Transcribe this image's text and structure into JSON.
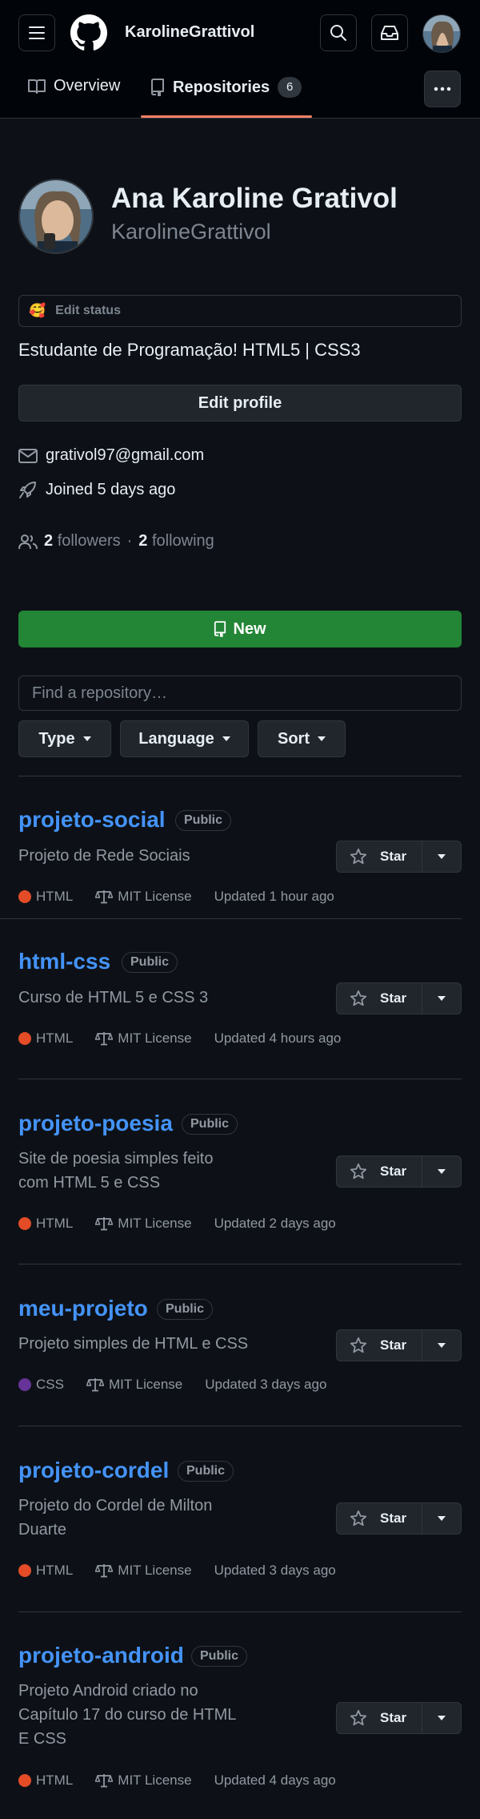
{
  "header": {
    "username": "KarolineGrattivol",
    "tabs": [
      {
        "label": "Overview"
      },
      {
        "label": "Repositories",
        "count": "6"
      }
    ]
  },
  "profile": {
    "full_name": "Ana Karoline Grativol",
    "login": "KarolineGrattivol",
    "status_label": "Edit status",
    "status_emoji": "🥰",
    "bio": "Estudante de Programação! HTML5 | CSS3",
    "edit_profile_label": "Edit profile",
    "email": "grativol97@gmail.com",
    "joined": "Joined 5 days ago",
    "followers_count": "2",
    "followers_label": "followers",
    "separator": "·",
    "following_count": "2",
    "following_label": "following"
  },
  "repos_toolbar": {
    "new_label": "New",
    "find_placeholder": "Find a repository…",
    "filters": [
      "Type",
      "Language",
      "Sort"
    ]
  },
  "repositories": [
    {
      "name": "projeto-social",
      "visibility": "Public",
      "description": "Projeto de Rede Sociais",
      "language": "HTML",
      "language_color": "#e34c26",
      "license": "MIT License",
      "updated": "Updated 1 hour ago",
      "star_label": "Star"
    },
    {
      "name": "html-css",
      "visibility": "Public",
      "description": "Curso de HTML 5 e CSS 3",
      "language": "HTML",
      "language_color": "#e34c26",
      "license": "MIT License",
      "updated": "Updated 4 hours ago",
      "star_label": "Star"
    },
    {
      "name": "projeto-poesia",
      "visibility": "Public",
      "description": "Site de poesia simples feito com HTML 5 e CSS",
      "language": "HTML",
      "language_color": "#e34c26",
      "license": "MIT License",
      "updated": "Updated 2 days ago",
      "star_label": "Star"
    },
    {
      "name": "meu-projeto",
      "visibility": "Public",
      "description": "Projeto simples de HTML e CSS",
      "language": "CSS",
      "language_color": "#663399",
      "license": "MIT License",
      "updated": "Updated 3 days ago",
      "star_label": "Star"
    },
    {
      "name": "projeto-cordel",
      "visibility": "Public",
      "description": "Projeto do Cordel de Milton Duarte",
      "language": "HTML",
      "language_color": "#e34c26",
      "license": "MIT License",
      "updated": "Updated 3 days ago",
      "star_label": "Star"
    },
    {
      "name": "projeto-android",
      "visibility": "Public",
      "description": "Projeto Android criado no Capítulo 17 do curso de HTML E CSS",
      "language": "HTML",
      "language_color": "#e34c26",
      "license": "MIT License",
      "updated": "Updated 4 days ago",
      "star_label": "Star"
    }
  ],
  "colors": {
    "background": "#0d1117",
    "header_bg": "#010409",
    "link": "#4493f8",
    "new_button": "#238636",
    "tab_underline": "#f78166"
  },
  "icons": [
    "menu-icon",
    "github-logo-icon",
    "search-icon",
    "inbox-icon",
    "book-icon",
    "repo-icon",
    "kebab-icon",
    "mail-icon",
    "rocket-icon",
    "people-icon",
    "star-icon",
    "law-icon",
    "triangle-down-icon"
  ]
}
